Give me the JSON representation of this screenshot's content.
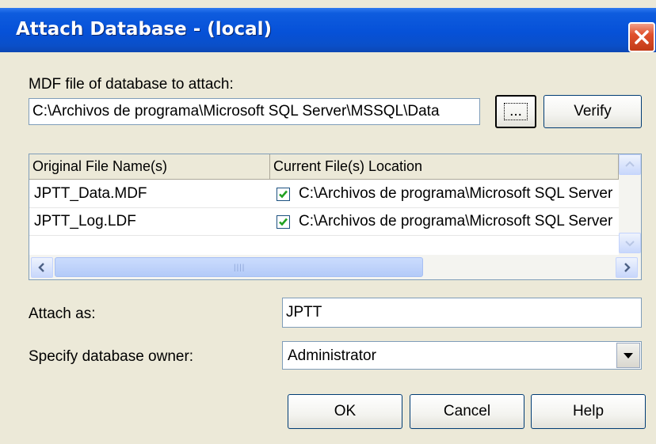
{
  "window": {
    "title": "Attach Database - (local)"
  },
  "mdf": {
    "label": "MDF file of database to attach:",
    "path": "C:\\Archivos de programa\\Microsoft SQL Server\\MSSQL\\Data",
    "browse_label": "...",
    "verify_label": "Verify"
  },
  "files_table": {
    "columns": [
      "Original File Name(s)",
      "Current File(s) Location"
    ],
    "rows": [
      {
        "name": "JPTT_Data.MDF",
        "location": "C:\\Archivos de programa\\Microsoft SQL Server",
        "checked": true
      },
      {
        "name": "JPTT_Log.LDF",
        "location": "C:\\Archivos de programa\\Microsoft SQL Server",
        "checked": true
      }
    ]
  },
  "attach_as": {
    "label": "Attach as:",
    "value": "JPTT"
  },
  "owner": {
    "label": "Specify database owner:",
    "value": "Administrator"
  },
  "buttons": {
    "ok": "OK",
    "cancel": "Cancel",
    "help": "Help"
  },
  "icons": {
    "close": "close-icon",
    "check": "checkmark-icon",
    "dropdown": "chevron-down-icon"
  },
  "colors": {
    "titlebar": "#0651d8",
    "close": "#e0502c",
    "dialog_bg": "#ece9d8",
    "check": "#21a121"
  }
}
